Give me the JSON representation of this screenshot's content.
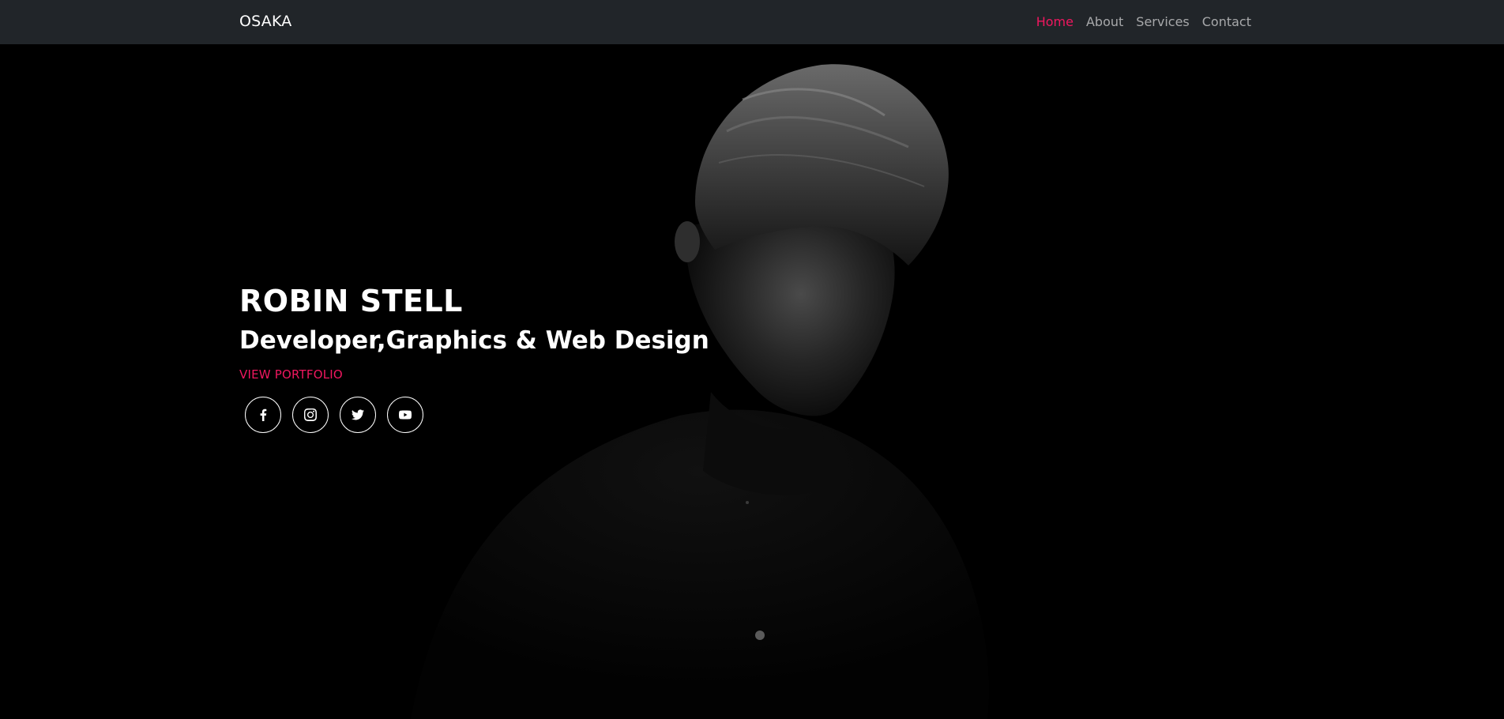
{
  "nav": {
    "brand": "OSAKA",
    "items": [
      {
        "label": "Home",
        "active": true
      },
      {
        "label": "About",
        "active": false
      },
      {
        "label": "Services",
        "active": false
      },
      {
        "label": "Contact",
        "active": false
      }
    ]
  },
  "hero": {
    "name": "ROBIN STELL",
    "tagline": "Developer,Graphics & Web Design",
    "cta": "VIEW PORTFOLIO",
    "socials": [
      {
        "icon": "facebook-icon"
      },
      {
        "icon": "instagram-icon"
      },
      {
        "icon": "twitter-icon"
      },
      {
        "icon": "youtube-icon"
      }
    ]
  },
  "colors": {
    "accent": "#f0175f",
    "navbar": "#212529",
    "background": "#000000"
  }
}
